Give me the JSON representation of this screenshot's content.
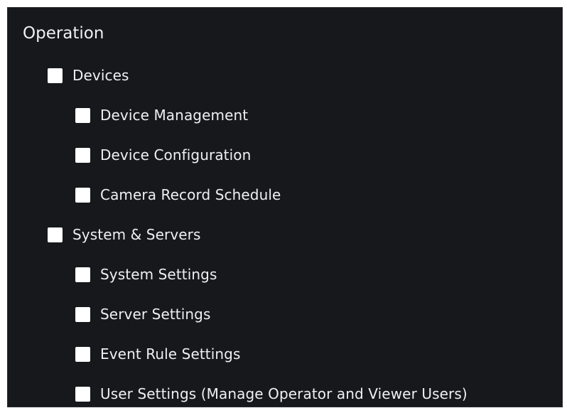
{
  "section": {
    "title": "Operation"
  },
  "groups": [
    {
      "label": "Devices",
      "checked": false,
      "children": [
        {
          "label": "Device Management",
          "checked": false
        },
        {
          "label": "Device Configuration",
          "checked": false
        },
        {
          "label": "Camera Record Schedule",
          "checked": false
        }
      ]
    },
    {
      "label": "System & Servers",
      "checked": false,
      "children": [
        {
          "label": "System Settings",
          "checked": false
        },
        {
          "label": "Server Settings",
          "checked": false
        },
        {
          "label": "Event Rule Settings",
          "checked": false
        },
        {
          "label": "User Settings (Manage Operator and Viewer Users)",
          "checked": false
        }
      ]
    }
  ],
  "colors": {
    "panel_background": "#16181b",
    "text": "#eef0f2",
    "checkbox": "#ffffff"
  }
}
